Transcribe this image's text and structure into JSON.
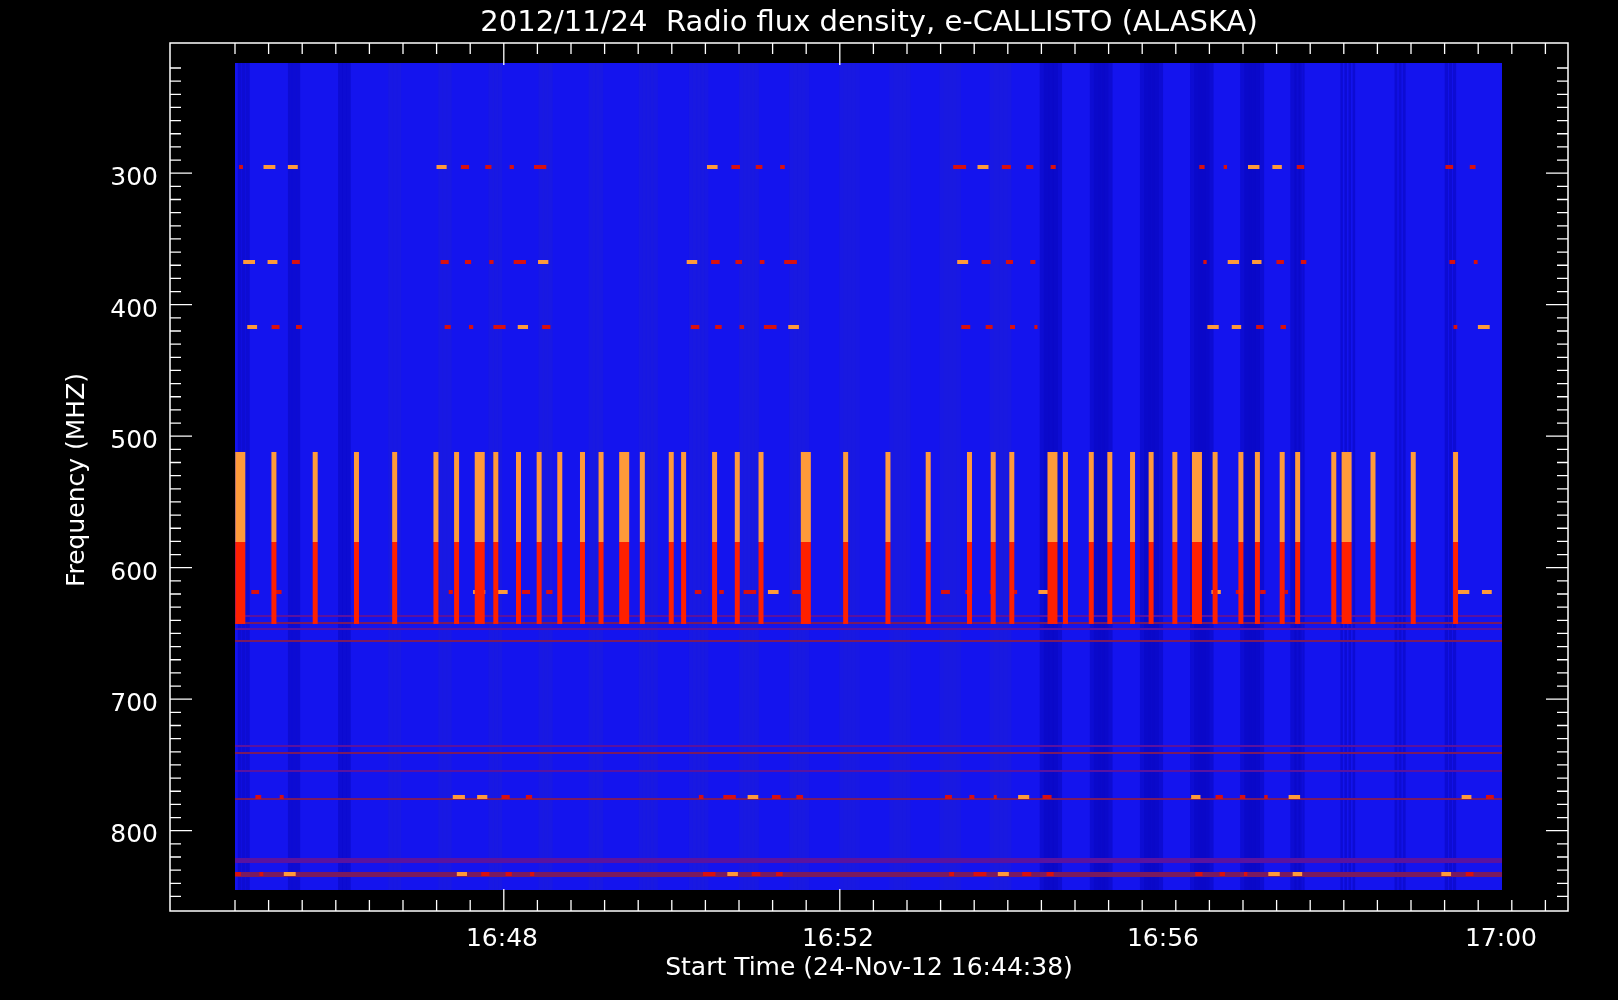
{
  "title": "2012/11/24  Radio flux density, e-CALLISTO (ALASKA)",
  "ylabel": "Frequency (MHZ)",
  "xlabel": "Start Time (24-Nov-12 16:44:38)",
  "yticks": [
    "300",
    "400",
    "500",
    "600",
    "700",
    "800"
  ],
  "xticks": [
    "16:48",
    "16:52",
    "16:56",
    "17:00"
  ]
}
